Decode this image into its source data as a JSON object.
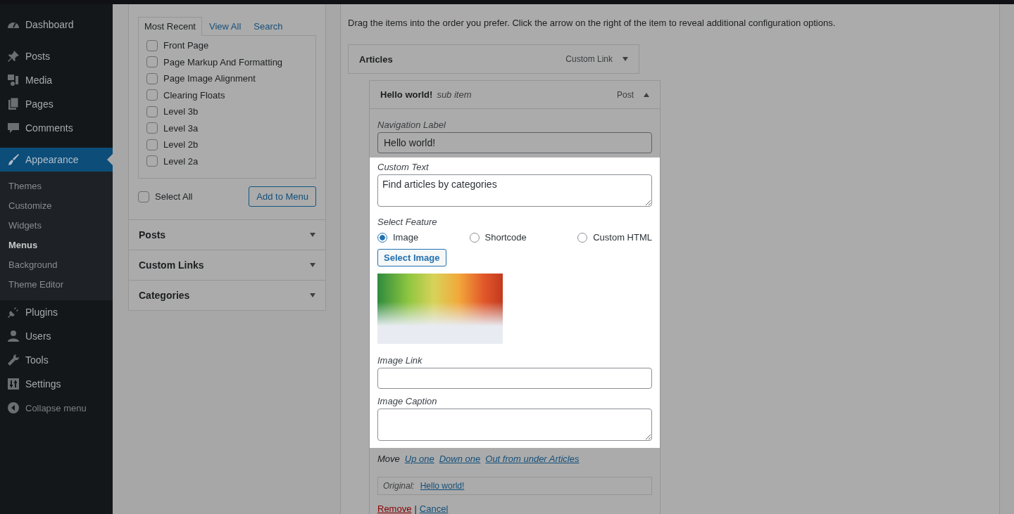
{
  "sidebar": {
    "items": [
      {
        "label": "Dashboard",
        "selected": false
      },
      {
        "label": "Posts",
        "selected": false
      },
      {
        "label": "Media",
        "selected": false
      },
      {
        "label": "Pages",
        "selected": false
      },
      {
        "label": "Comments",
        "selected": false
      },
      {
        "label": "Appearance",
        "selected": true,
        "children": [
          {
            "label": "Themes",
            "selected": false
          },
          {
            "label": "Customize",
            "selected": false
          },
          {
            "label": "Widgets",
            "selected": false
          },
          {
            "label": "Menus",
            "selected": true
          },
          {
            "label": "Background",
            "selected": false
          },
          {
            "label": "Theme Editor",
            "selected": false
          }
        ]
      },
      {
        "label": "Plugins",
        "selected": false
      },
      {
        "label": "Users",
        "selected": false
      },
      {
        "label": "Tools",
        "selected": false
      },
      {
        "label": "Settings",
        "selected": false
      }
    ],
    "collapse": "Collapse menu"
  },
  "pages_box": {
    "tabs": [
      {
        "label": "Most Recent",
        "selected": true
      },
      {
        "label": "View All",
        "selected": false
      },
      {
        "label": "Search",
        "selected": false
      }
    ],
    "items": [
      {
        "label": "Front Page",
        "checked": false
      },
      {
        "label": "Page Markup And Formatting",
        "checked": false
      },
      {
        "label": "Page Image Alignment",
        "checked": false
      },
      {
        "label": "Clearing Floats",
        "checked": false
      },
      {
        "label": "Level 3b",
        "checked": false
      },
      {
        "label": "Level 3a",
        "checked": false
      },
      {
        "label": "Level 2b",
        "checked": false
      },
      {
        "label": "Level 2a",
        "checked": false
      }
    ],
    "select_all": {
      "label": "Select All",
      "checked": false
    },
    "add_button": "Add to Menu"
  },
  "sections": [
    {
      "label": "Posts",
      "expanded": false
    },
    {
      "label": "Custom Links",
      "expanded": false
    },
    {
      "label": "Categories",
      "expanded": false
    }
  ],
  "menu": {
    "instructions": "Drag the items into the order you prefer. Click the arrow on the right of the item to reveal additional configuration options.",
    "items": [
      {
        "title": "Articles",
        "type": "Custom Link",
        "expanded": false
      },
      {
        "title": "Hello world!",
        "subtitle": "sub item",
        "type": "Post",
        "expanded": true,
        "navigation_label": {
          "label": "Navigation Label",
          "value": "Hello world!"
        },
        "custom_text": {
          "label": "Custom Text",
          "value": "Find articles by categories"
        },
        "feature": {
          "label": "Select Feature",
          "options": [
            {
              "label": "Image",
              "selected": true
            },
            {
              "label": "Shortcode",
              "selected": false
            },
            {
              "label": "Custom HTML",
              "selected": false
            }
          ]
        },
        "select_image": "Select Image",
        "image_link": {
          "label": "Image Link"
        },
        "image_caption": {
          "label": "Image Caption"
        },
        "move": {
          "label": "Move",
          "links": [
            "Up one",
            "Down one",
            "Out from under Articles"
          ]
        },
        "original": {
          "label": "Original:",
          "link": "Hello world!"
        },
        "remove": "Remove",
        "separator": "|",
        "cancel": "Cancel"
      }
    ]
  }
}
